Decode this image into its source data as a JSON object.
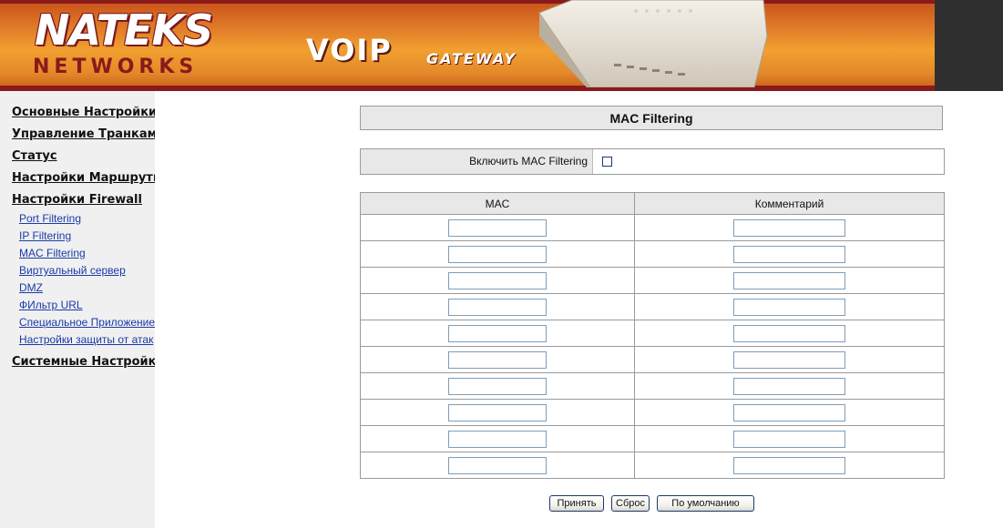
{
  "header": {
    "logo_top": "NATEKS",
    "logo_bottom": "NETWORKS",
    "voip": "VOIP",
    "gateway": "GATEWAY"
  },
  "sidebar": {
    "items": [
      {
        "label": "Основные Настройки"
      },
      {
        "label": "Управление Транками"
      },
      {
        "label": "Статус"
      },
      {
        "label": "Настройки Маршрутизации"
      },
      {
        "label": "Настройки Firewall"
      },
      {
        "label": "Системные Настройки"
      }
    ],
    "firewall_sub": [
      {
        "label": "Port Filtering"
      },
      {
        "label": "IP Filtering"
      },
      {
        "label": "MAC Filtering"
      },
      {
        "label": "Виртуальный сервер"
      },
      {
        "label": "DMZ"
      },
      {
        "label": "ФИльтр URL"
      },
      {
        "label": "Специальное Приложение"
      },
      {
        "label": "Настройки защиты от атак"
      }
    ]
  },
  "main": {
    "title": "MAC Filtering",
    "enable_label": "Включить MAC Filtering",
    "enable_checked": false,
    "table": {
      "headers": [
        "MAC",
        "Комментарий"
      ],
      "rows": [
        {
          "mac": "",
          "comment": ""
        },
        {
          "mac": "",
          "comment": ""
        },
        {
          "mac": "",
          "comment": ""
        },
        {
          "mac": "",
          "comment": ""
        },
        {
          "mac": "",
          "comment": ""
        },
        {
          "mac": "",
          "comment": ""
        },
        {
          "mac": "",
          "comment": ""
        },
        {
          "mac": "",
          "comment": ""
        },
        {
          "mac": "",
          "comment": ""
        },
        {
          "mac": "",
          "comment": ""
        }
      ]
    },
    "buttons": {
      "apply": "Принять",
      "reset": "Сброс",
      "default": "По умолчанию"
    }
  },
  "colors": {
    "banner_orange": "#f1a030",
    "banner_dark_red": "#8a1a1a",
    "link_blue": "#1a3aa8",
    "header_gray": "#e8e8e8",
    "sidebar_bg": "#f0f0f0"
  }
}
